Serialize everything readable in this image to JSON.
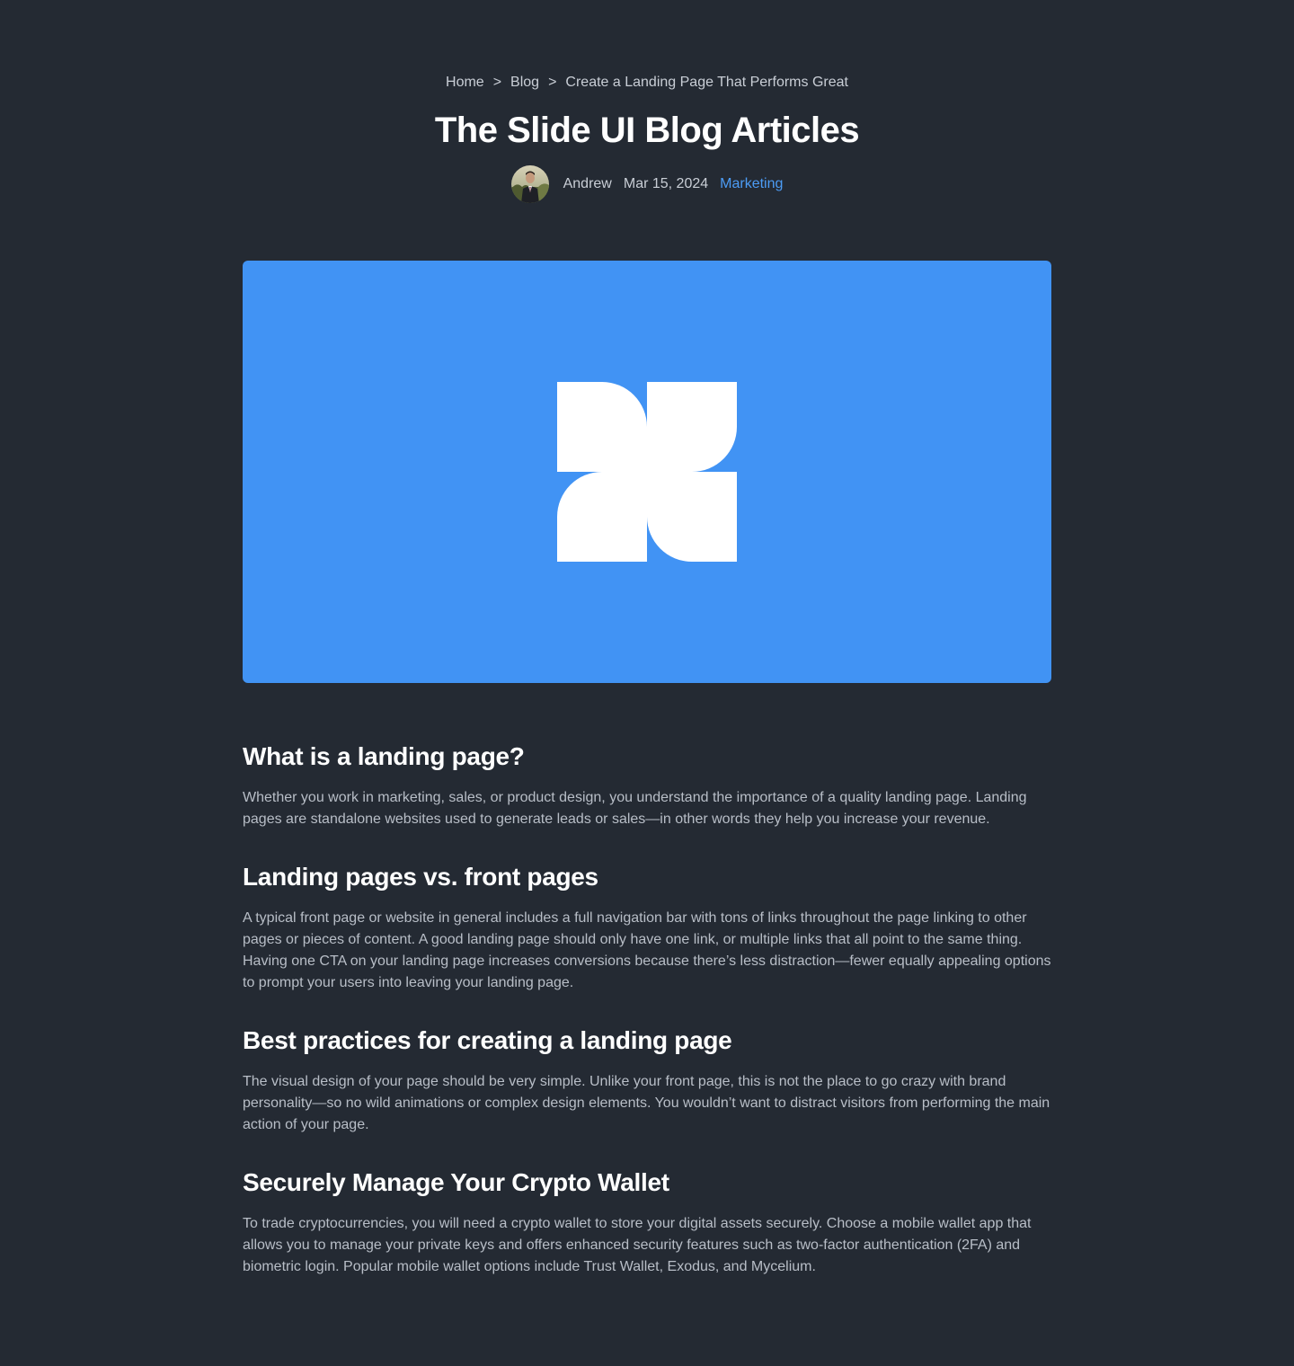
{
  "breadcrumb": {
    "home": "Home",
    "blog": "Blog",
    "current": "Create a Landing Page That Performs Great",
    "separator": ">"
  },
  "header": {
    "title": "The Slide UI Blog Articles"
  },
  "meta": {
    "author": "Andrew",
    "date": "Mar 15, 2024",
    "category": "Marketing"
  },
  "colors": {
    "background": "#242a33",
    "hero": "#4193f4",
    "accent": "#4c9cf5",
    "logo_mark": "#ffffff"
  },
  "hero": {
    "icon": "slide-ui-logo-icon"
  },
  "sections": [
    {
      "heading": "What is a landing page?",
      "body": "Whether you work in marketing, sales, or product design, you understand the importance of a quality landing page. Landing pages are standalone websites used to generate leads or sales—in other words they help you increase your revenue."
    },
    {
      "heading": "Landing pages vs. front pages",
      "body": "A typical front page or website in general includes a full navigation bar with tons of links throughout the page linking to other pages or pieces of content. A good landing page should only have one link, or multiple links that all point to the same thing. Having one CTA on your landing page increases conversions because there’s less distraction—fewer equally appealing options to prompt your users into leaving your landing page."
    },
    {
      "heading": "Best practices for creating a landing page",
      "body": "The visual design of your page should be very simple. Unlike your front page, this is not the place to go crazy with brand personality—so no wild animations or complex design elements. You wouldn’t want to distract visitors from performing the main action of your page."
    },
    {
      "heading": "Securely Manage Your Crypto Wallet",
      "body": "To trade cryptocurrencies, you will need a crypto wallet to store your digital assets securely. Choose a mobile wallet app that allows you to manage your private keys and offers enhanced security features such as two-factor authentication (2FA) and biometric login. Popular mobile wallet options include Trust Wallet, Exodus, and Mycelium."
    }
  ]
}
